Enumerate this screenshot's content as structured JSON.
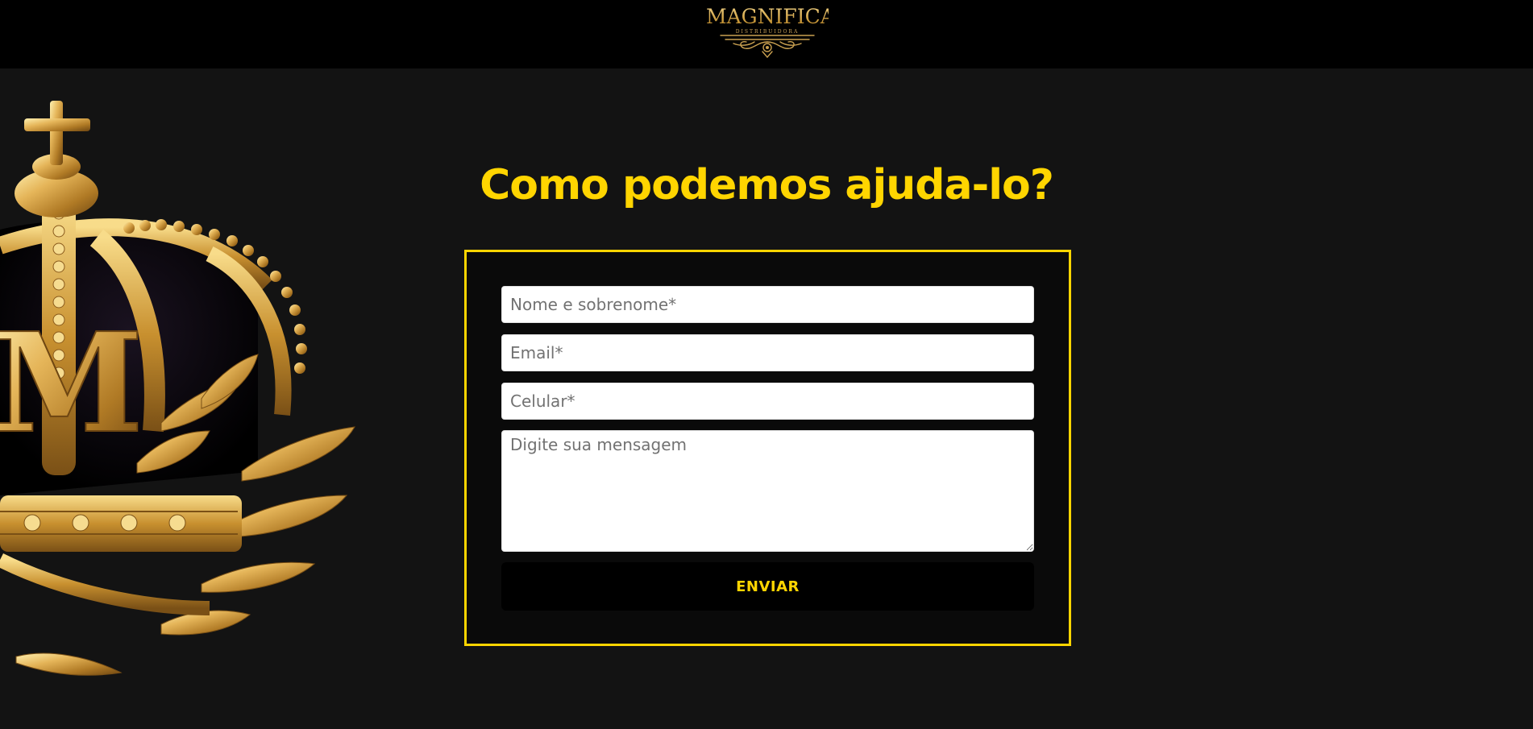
{
  "header": {
    "logo_text": "MAGNIFICAT",
    "logo_subtext": "DISTRIBUIDORA"
  },
  "main": {
    "heading": "Como podemos ajuda-lo?"
  },
  "form": {
    "name_placeholder": "Nome e sobrenome*",
    "email_placeholder": "Email*",
    "phone_placeholder": "Celular*",
    "message_placeholder": "Digite sua mensagem",
    "submit_label": "ENVIAR"
  },
  "colors": {
    "accent": "#ffd500",
    "background": "#131313",
    "header_bg": "#000000"
  },
  "icons": {
    "crown": "crown-icon",
    "logo_ornament": "ornament-icon"
  }
}
